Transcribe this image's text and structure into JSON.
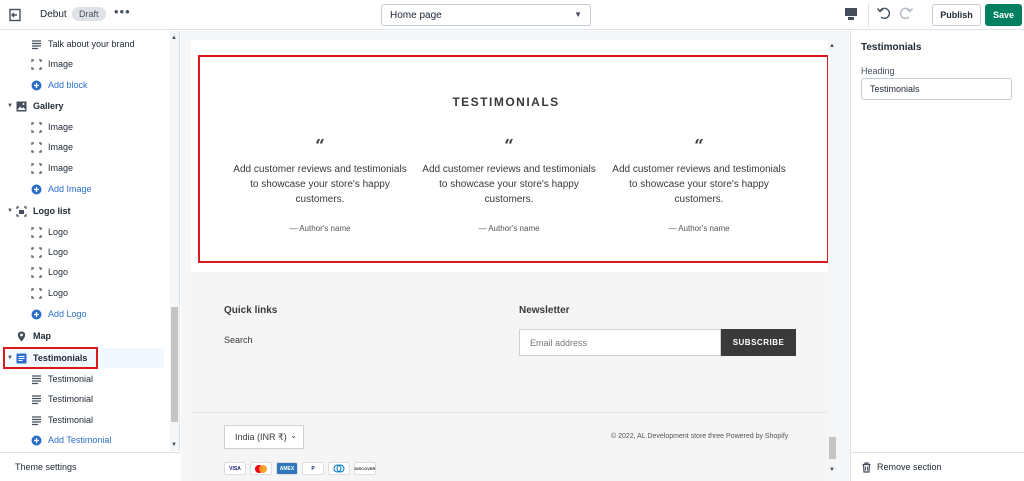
{
  "topbar": {
    "theme_name": "Debut",
    "theme_status": "Draft",
    "more_label": "•••",
    "page_select": "Home page",
    "publish_label": "Publish",
    "save_label": "Save"
  },
  "sidebar": {
    "items": [
      {
        "label": "Talk about your brand",
        "icon": "text-block-icon"
      },
      {
        "label": "Image",
        "icon": "image-placeholder-icon"
      },
      {
        "label": "Add block",
        "icon": "plus-circle-icon"
      },
      {
        "label": "Gallery",
        "icon": "image-icon"
      },
      {
        "label": "Image",
        "icon": "image-placeholder-icon"
      },
      {
        "label": "Image",
        "icon": "image-placeholder-icon"
      },
      {
        "label": "Image",
        "icon": "image-placeholder-icon"
      },
      {
        "label": "Add Image",
        "icon": "plus-circle-icon"
      },
      {
        "label": "Logo list",
        "icon": "logo-list-icon"
      },
      {
        "label": "Logo",
        "icon": "image-placeholder-icon"
      },
      {
        "label": "Logo",
        "icon": "image-placeholder-icon"
      },
      {
        "label": "Logo",
        "icon": "image-placeholder-icon"
      },
      {
        "label": "Logo",
        "icon": "image-placeholder-icon"
      },
      {
        "label": "Add Logo",
        "icon": "plus-circle-icon"
      },
      {
        "label": "Map",
        "icon": "map-pin-icon"
      },
      {
        "label": "Testimonials",
        "icon": "testimonials-icon"
      },
      {
        "label": "Testimonial",
        "icon": "text-block-icon"
      },
      {
        "label": "Testimonial",
        "icon": "text-block-icon"
      },
      {
        "label": "Testimonial",
        "icon": "text-block-icon"
      },
      {
        "label": "Add Testimonial",
        "icon": "plus-circle-icon"
      }
    ],
    "theme_settings": "Theme settings"
  },
  "preview": {
    "testimonials": {
      "title": "TESTIMONIALS",
      "quote_mark": "“",
      "cols": [
        {
          "body": "Add customer reviews and testimonials to showcase your store's happy customers.",
          "author": "— Author's name"
        },
        {
          "body": "Add customer reviews and testimonials to showcase your store's happy customers.",
          "author": "— Author's name"
        },
        {
          "body": "Add customer reviews and testimonials to showcase your store's happy customers.",
          "author": "— Author's name"
        }
      ]
    },
    "footer": {
      "quick_links_title": "Quick links",
      "quick_link": "Search",
      "newsletter_title": "Newsletter",
      "email_placeholder": "Email address",
      "subscribe_label": "SUBSCRIBE",
      "currency": "India (INR ₹)",
      "copyright": "© 2022, AL Development store three Powered by Shopify",
      "payment_methods": [
        "VISA",
        "MC",
        "AMEX",
        "PayPal",
        "Diners",
        "DISCOVER"
      ]
    }
  },
  "rightpanel": {
    "title": "Testimonials",
    "heading_label": "Heading",
    "heading_value": "Testimonials",
    "remove_label": "Remove section"
  },
  "colors": {
    "accent_blue": "#2c6ecb",
    "save_green": "#008060",
    "highlight_red": "#d71920"
  }
}
